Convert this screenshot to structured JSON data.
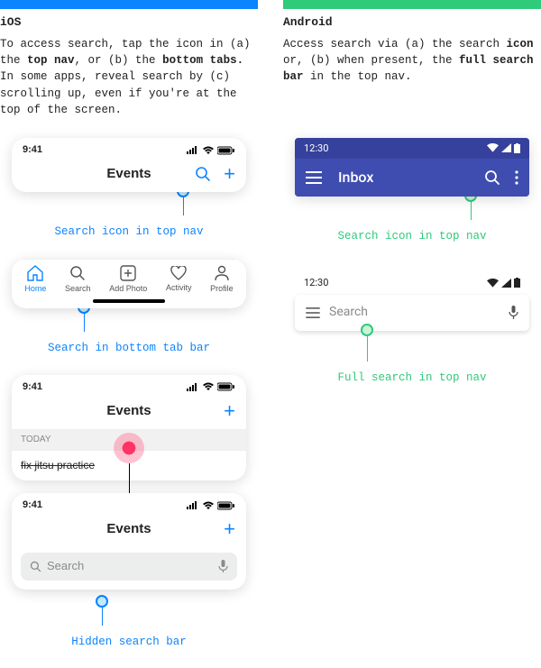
{
  "ios": {
    "heading": "iOS",
    "desc_parts": {
      "p1": "To access search, tap the icon in (a) the ",
      "b1": "top nav",
      "p2": ", or (b) the ",
      "b2": "bottom tabs.",
      "p3": " In some apps, reveal search by (c) scrolling up, even if you're at the top of the screen."
    },
    "time": "9:41",
    "nav_title": "Events",
    "caption1": "Search icon in top nav",
    "tabs": {
      "home": "Home",
      "search": "Search",
      "add": "Add Photo",
      "activity": "Activity",
      "profile": "Profile"
    },
    "caption2": "Search in bottom tab bar",
    "section_label": "TODAY",
    "list_item": "fix jitsu practice",
    "search_placeholder": "Search",
    "caption3": "Hidden search bar"
  },
  "android": {
    "heading": "Android",
    "desc_parts": {
      "p1": "Access search via (a) the search ",
      "b1": "icon",
      "p2": " or, (b) when present, the ",
      "b2": "full search bar",
      "p3": " in the top nav."
    },
    "time": "12:30",
    "title": "Inbox",
    "caption1": "Search icon in top nav",
    "search_placeholder": "Search",
    "caption2": "Full search in top nav"
  }
}
